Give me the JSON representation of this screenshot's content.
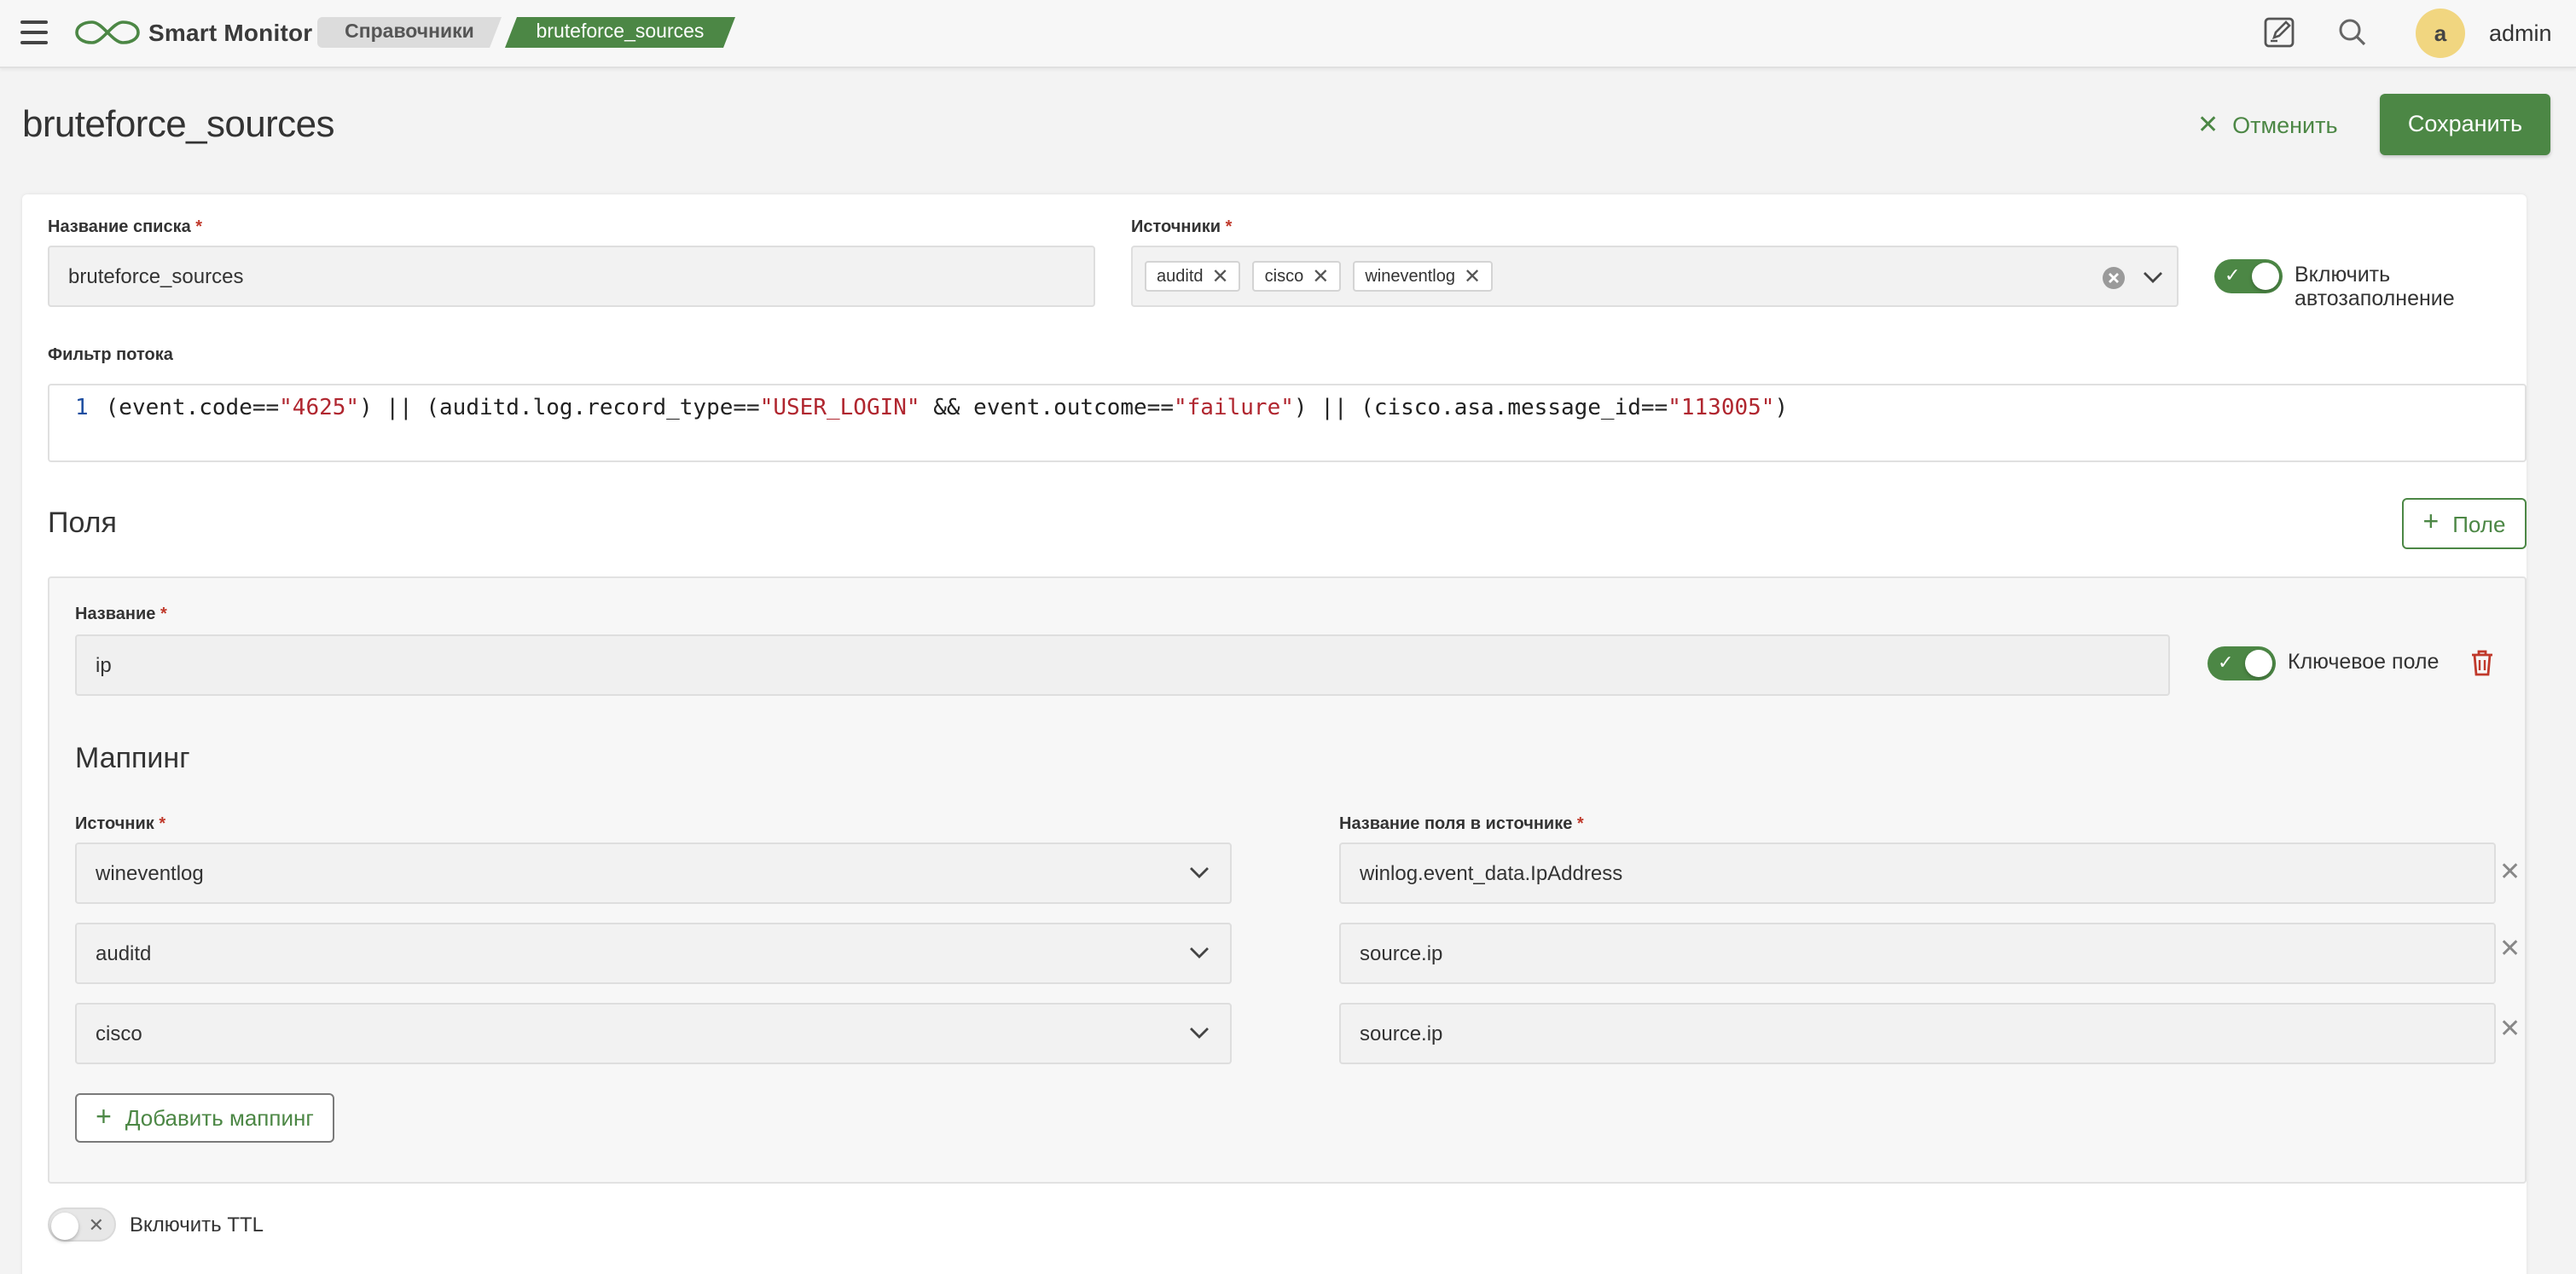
{
  "topbar": {
    "brand": "Smart Monitor",
    "breadcrumbs": [
      "Справочники",
      "bruteforce_sources"
    ],
    "user": {
      "initial": "a",
      "name": "admin"
    },
    "icons": [
      "menu-icon",
      "infinity-logo-icon",
      "edit-note-icon",
      "search-icon"
    ]
  },
  "header": {
    "title": "bruteforce_sources",
    "cancel_label": "Отменить",
    "save_label": "Сохранить"
  },
  "form": {
    "list_name": {
      "label": "Название списка",
      "value": "bruteforce_sources"
    },
    "sources": {
      "label": "Источники",
      "chips": [
        "auditd",
        "cisco",
        "wineventlog"
      ]
    },
    "autofill": {
      "label": "Включить автозаполнение",
      "enabled": true
    },
    "stream_filter": {
      "label": "Фильтр потока",
      "line_number": "1",
      "parts": [
        {
          "t": "(event.code==",
          "s": false
        },
        {
          "t": "\"4625\"",
          "s": true
        },
        {
          "t": ") || (auditd.log.record_type==",
          "s": false
        },
        {
          "t": "\"USER_LOGIN\"",
          "s": true
        },
        {
          "t": " && event.outcome==",
          "s": false
        },
        {
          "t": "\"failure\"",
          "s": true
        },
        {
          "t": ") || (cisco.asa.message_id==",
          "s": false
        },
        {
          "t": "\"113005\"",
          "s": true
        },
        {
          "t": ")",
          "s": false
        }
      ]
    }
  },
  "fields": {
    "title": "Поля",
    "add_label": "Поле",
    "item": {
      "name_label": "Название",
      "name_value": "ip",
      "key_field_label": "Ключевое поле",
      "key_field_enabled": true,
      "mapping_title": "Маппинг",
      "source_label": "Источник",
      "field_name_label": "Название поля в источнике",
      "mappings": [
        {
          "source": "wineventlog",
          "field": "winlog.event_data.IpAddress"
        },
        {
          "source": "auditd",
          "field": "source.ip"
        },
        {
          "source": "cisco",
          "field": "source.ip"
        }
      ],
      "add_mapping_label": "Добавить маппинг"
    }
  },
  "ttl": {
    "label": "Включить TTL",
    "enabled": false
  },
  "colors": {
    "accent": "#4c8745",
    "required": "#c0392b",
    "avatar": "#f1d680",
    "danger_icon": "#c0392b"
  }
}
